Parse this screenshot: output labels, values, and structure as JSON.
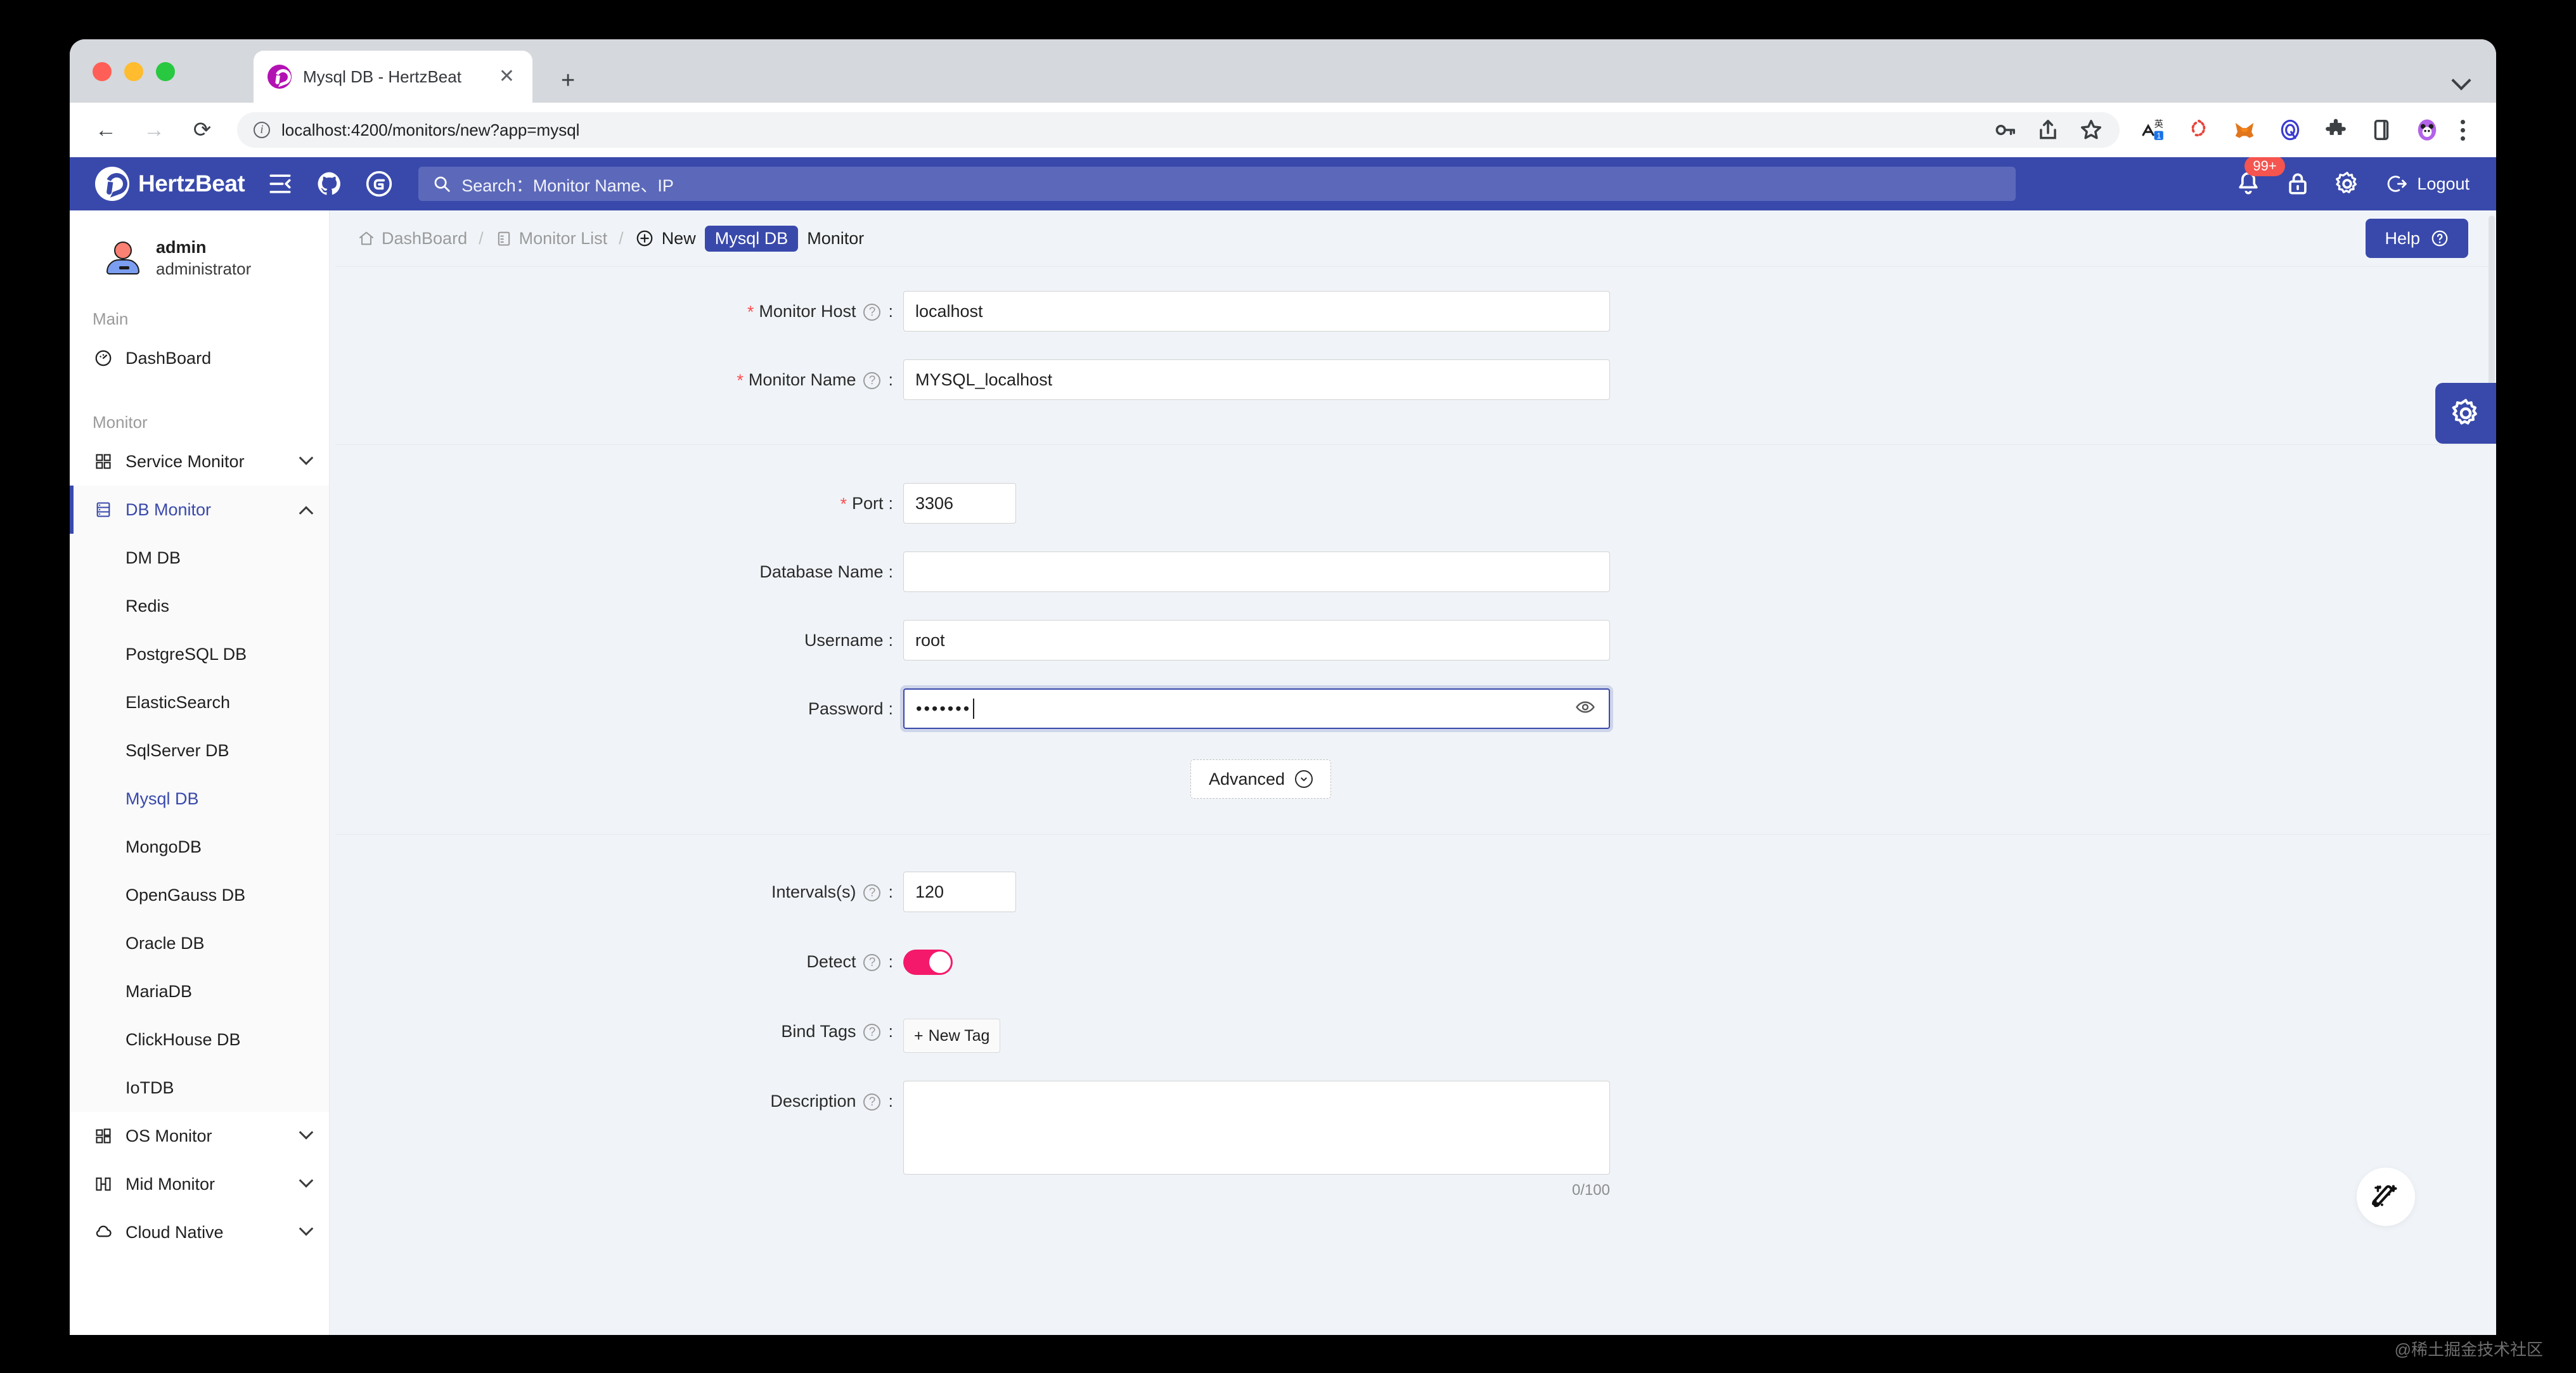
{
  "browser": {
    "tab": {
      "title": "Mysql DB - HertzBeat",
      "close_label": "✕",
      "favicon": "hertzbeat-favicon"
    },
    "new_tab_label": "+",
    "nav": {
      "back": "←",
      "forward": "→",
      "reload": "⟳"
    },
    "url": "localhost:4200/monitors/new?app=mysql",
    "omnibox_icons": [
      "key-icon",
      "share-icon",
      "bookmark-star-icon"
    ],
    "extension_icons": [
      "translate-icon",
      "coral-extension-icon",
      "metamask-fox-icon",
      "qi-circle-icon",
      "puzzle-extensions-icon",
      "sidepanel-icon"
    ],
    "profile": "panda-avatar",
    "menu": "kebab-menu"
  },
  "app_header": {
    "brand": "HertzBeat",
    "collapse_icon": "sidebar-collapse-icon",
    "github_icon": "github-icon",
    "gitee_icon": "gitee-icon",
    "search_placeholder": "Search：Monitor Name、IP",
    "notification_badge": "99+",
    "lock_icon": "lock-icon",
    "settings_icon": "gear-icon",
    "logout_label": "Logout"
  },
  "sidebar": {
    "user": {
      "name": "admin",
      "role": "administrator"
    },
    "groups": [
      {
        "title": "Main",
        "items": [
          {
            "label": "DashBoard",
            "icon": "dashboard-icon",
            "expandable": false
          }
        ]
      },
      {
        "title": "Monitor",
        "items": [
          {
            "label": "Service Monitor",
            "icon": "grid-icon",
            "expandable": true,
            "open": false
          },
          {
            "label": "DB Monitor",
            "icon": "database-icon",
            "expandable": true,
            "open": true,
            "active": true
          },
          {
            "label": "OS Monitor",
            "icon": "windows-icon",
            "expandable": true,
            "open": false
          },
          {
            "label": "Mid Monitor",
            "icon": "middleware-icon",
            "expandable": true,
            "open": false
          },
          {
            "label": "Cloud Native",
            "icon": "cloud-icon",
            "expandable": true,
            "open": false
          }
        ]
      }
    ],
    "db_submenu": [
      {
        "label": "DM DB",
        "active": false
      },
      {
        "label": "Redis",
        "active": false
      },
      {
        "label": "PostgreSQL DB",
        "active": false
      },
      {
        "label": "ElasticSearch",
        "active": false
      },
      {
        "label": "SqlServer DB",
        "active": false
      },
      {
        "label": "Mysql DB",
        "active": true
      },
      {
        "label": "MongoDB",
        "active": false
      },
      {
        "label": "OpenGauss DB",
        "active": false
      },
      {
        "label": "Oracle DB",
        "active": false
      },
      {
        "label": "MariaDB",
        "active": false
      },
      {
        "label": "ClickHouse DB",
        "active": false
      },
      {
        "label": "IoTDB",
        "active": false
      }
    ]
  },
  "breadcrumb": {
    "dashboard": "DashBoard",
    "monitor_list": "Monitor List",
    "new": "New",
    "chip": "Mysql DB",
    "tail": "Monitor",
    "separator": "/"
  },
  "help_button": {
    "label": "Help",
    "icon": "question-circle-icon"
  },
  "form": {
    "monitor_host": {
      "label": "Monitor Host",
      "required": true,
      "value": "localhost",
      "help": true
    },
    "monitor_name": {
      "label": "Monitor Name",
      "required": true,
      "value": "MYSQL_localhost",
      "help": true
    },
    "port": {
      "label": "Port",
      "required": true,
      "value": "3306",
      "help": false
    },
    "database_name": {
      "label": "Database Name",
      "required": false,
      "value": "",
      "help": false
    },
    "username": {
      "label": "Username",
      "required": false,
      "value": "root",
      "help": false
    },
    "password": {
      "label": "Password",
      "required": false,
      "value": "•••••••",
      "masked_chars": 7,
      "focused": true,
      "reveal_icon": "eye-icon"
    },
    "advanced": {
      "label": "Advanced",
      "icon": "chevron-down-circle-icon"
    },
    "intervals": {
      "label": "Intervals(s)",
      "value": "120",
      "help": true
    },
    "detect": {
      "label": "Detect",
      "help": true,
      "enabled": true
    },
    "bind_tags": {
      "label": "Bind Tags",
      "help": true,
      "button_label": "New Tag",
      "button_icon": "plus-icon"
    },
    "description": {
      "label": "Description",
      "help": true,
      "value": "",
      "counter": "0/100"
    }
  },
  "floating": {
    "settings_tab_icon": "gear-icon",
    "wand_icon": "magic-wand-icon"
  },
  "watermark": "@稀土掘金技术社区",
  "colors": {
    "brand_blue": "#3949ab",
    "toggle_pink": "#f5196b",
    "required_red": "#ff4d4f",
    "badge_red": "#f5544f",
    "app_bg": "#f0f4f8"
  }
}
